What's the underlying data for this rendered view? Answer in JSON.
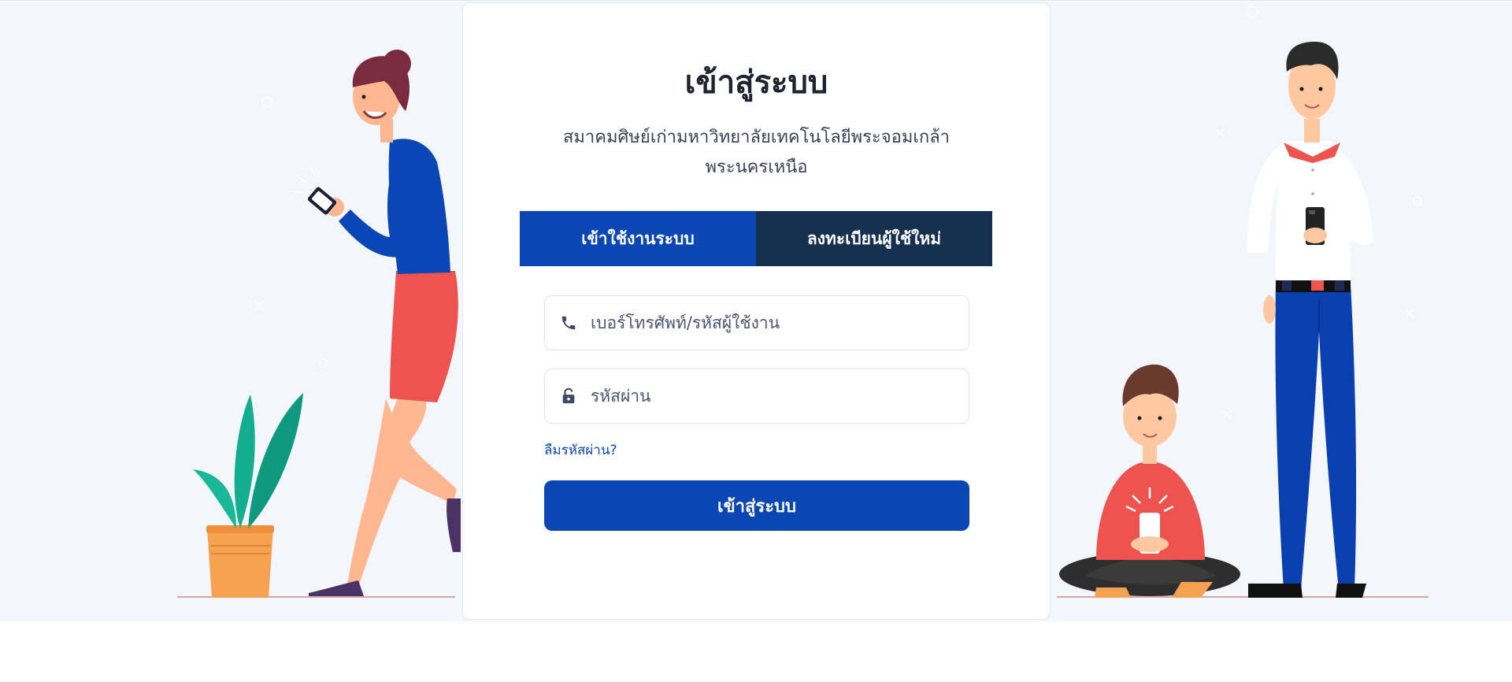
{
  "page": {
    "title": "เข้าสู่ระบบ",
    "subtitle_line1": "สมาคมศิษย์เก่ามหาวิทยาลัยเทคโนโลยีพระจอมเกล้า",
    "subtitle_line2": "พระนครเหนือ"
  },
  "tabs": [
    {
      "label": "เข้าใช้งานระบบ",
      "active": true
    },
    {
      "label": "ลงทะเบียนผู้ใช้ใหม่",
      "active": false
    }
  ],
  "form": {
    "username_placeholder": "เบอร์โทรศัพท์/รหัสผู้ใช้งาน",
    "password_placeholder": "รหัสผ่าน",
    "forgot_password": "ลืมรหัสผ่าน?",
    "submit_label": "เข้าสู่ระบบ"
  },
  "icons": {
    "username": "phone-icon",
    "password": "unlock-icon"
  },
  "colors": {
    "primary": "#0b47b4",
    "tab_inactive": "#16304f",
    "background": "#f3f6fa"
  }
}
